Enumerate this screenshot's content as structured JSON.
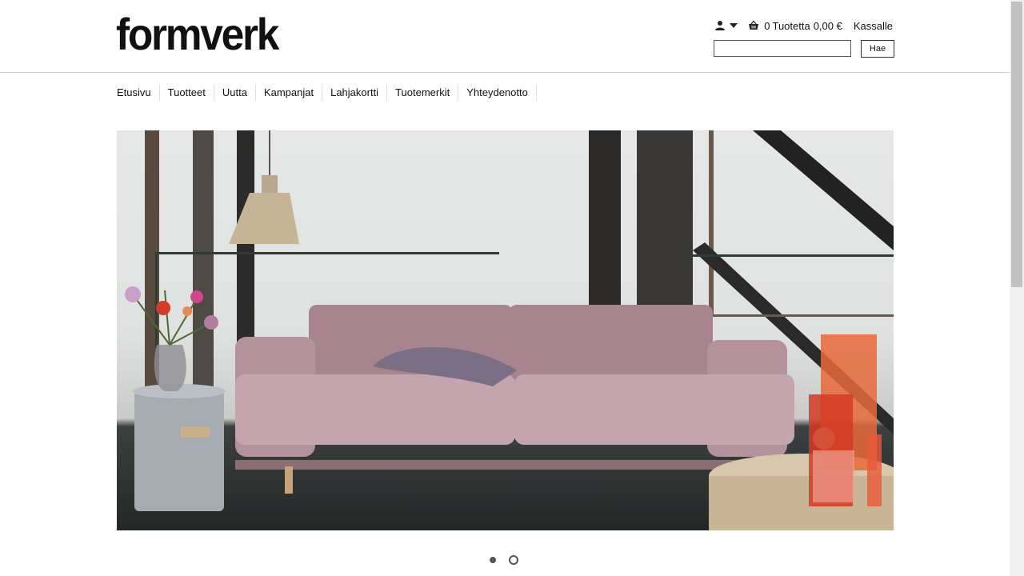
{
  "header": {
    "logo": "formverk",
    "cart_count": "0",
    "cart_label": "Tuotetta",
    "cart_total": "0,00 €",
    "checkout": "Kassalle",
    "search_value": "",
    "search_button": "Hae",
    "icons": [
      "user-icon",
      "caret-down-icon",
      "basket-icon"
    ]
  },
  "nav": {
    "items": [
      "Etusivu",
      "Tuotteet",
      "Uutta",
      "Kampanjat",
      "Lahjakortti",
      "Tuotemerkit",
      "Yhteydenotto"
    ]
  },
  "hero": {
    "slide_count": 2,
    "active_slide": 2
  }
}
